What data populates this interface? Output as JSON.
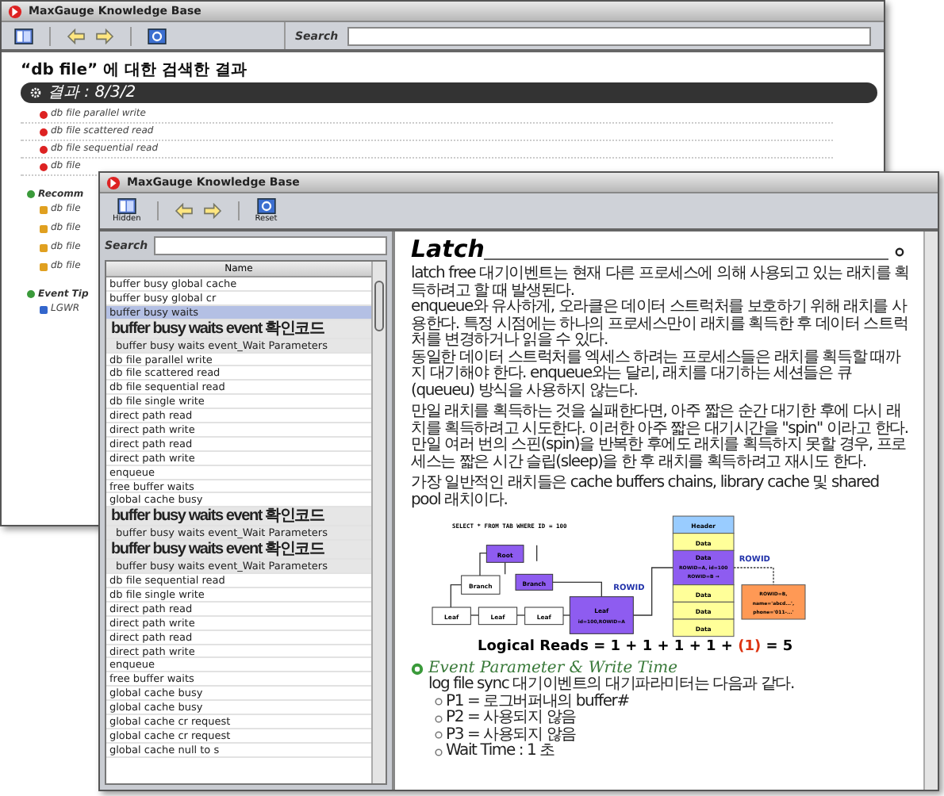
{
  "back_window": {
    "title": "MaxGauge Knowledge Base",
    "toolbar": [
      {
        "kind": "hidden"
      },
      {
        "kind": "back"
      },
      {
        "kind": "forward"
      },
      {
        "kind": "reset"
      }
    ],
    "search_label": "Search",
    "heading": "“db file” 에 대한 검색한 결과",
    "result_bar": "결과 : 8/3/2",
    "results": [
      "db file parallel write",
      "db file scattered read",
      "db file sequential read",
      "db file"
    ],
    "sections": [
      {
        "kind": "recommend",
        "title": "Recomm",
        "items": [
          "db file",
          "db file",
          "db file",
          "db file"
        ]
      },
      {
        "kind": "tip",
        "title": "Event Tip",
        "items": [
          "LGWR"
        ]
      }
    ]
  },
  "front_window": {
    "title": "MaxGauge Knowledge Base",
    "toolbar": [
      {
        "kind": "hidden",
        "label": "Hidden"
      },
      {
        "kind": "back"
      },
      {
        "kind": "forward"
      },
      {
        "kind": "reset",
        "label": "Reset"
      }
    ],
    "search_label": "Search",
    "list_header": "Name",
    "list": [
      {
        "label": "buffer busy global cache",
        "selected": false
      },
      {
        "label": "buffer busy global cr",
        "selected": false
      },
      {
        "label": "buffer busy waits",
        "selected": true,
        "children": [
          {
            "label": "buffer busy waits event 확인코드",
            "bold": true,
            "selected": false
          },
          {
            "label": "buffer busy waits event_Wait Parameters",
            "bold": false,
            "selected": false
          }
        ]
      },
      {
        "label": "db file parallel write",
        "selected": false
      },
      {
        "label": "db file scattered read",
        "selected": false
      },
      {
        "label": "db file sequential read",
        "selected": false
      },
      {
        "label": "db file single write",
        "selected": false
      },
      {
        "label": "direct path read",
        "selected": false
      },
      {
        "label": "direct path write",
        "selected": false
      },
      {
        "label": "direct path read",
        "selected": false
      },
      {
        "label": "direct path write",
        "selected": false
      },
      {
        "label": "enqueue",
        "selected": false
      },
      {
        "label": "free buffer waits",
        "selected": false
      },
      {
        "label": "global cache busy",
        "selected": false,
        "children": [
          {
            "label": "buffer busy waits event 확인코드",
            "bold": true,
            "selected": false
          },
          {
            "label": "buffer busy waits event_Wait Parameters",
            "bold": false,
            "selected": false
          },
          {
            "label": "buffer busy waits event 확인코드",
            "bold": true,
            "selected": false
          },
          {
            "label": "buffer busy waits event_Wait Parameters",
            "bold": false,
            "selected": false
          }
        ]
      },
      {
        "label": "db file sequential read",
        "selected": false
      },
      {
        "label": "db file single write",
        "selected": false
      },
      {
        "label": "direct path read",
        "selected": false
      },
      {
        "label": "direct path write",
        "selected": false
      },
      {
        "label": "direct path read",
        "selected": false
      },
      {
        "label": "direct path write",
        "selected": false
      },
      {
        "label": "enqueue",
        "selected": false
      },
      {
        "label": "free buffer waits",
        "selected": false
      },
      {
        "label": "global cache busy",
        "selected": false
      },
      {
        "label": "global cache busy",
        "selected": false
      },
      {
        "label": "global cache cr request",
        "selected": false
      },
      {
        "label": "global cache cr request",
        "selected": false
      },
      {
        "label": "global cache null to s",
        "selected": false
      }
    ],
    "article": {
      "title": "Latch",
      "paragraphs": [
        [
          "latch free 대기이벤트는 현재 다른 프로세스에 의해 사용되고 있는 래치를 획득하려고 할 때 발생된다.",
          "enqueue와 유사하게, 오라클은 데이터 스트럭처를 보호하기 위해 래치를 사용한다. 특정 시점에는 하나의 프로세스만이 래치를 획득한 후 데이터 스트럭처를 변경하거나 읽을 수 있다.",
          "동일한 데이터 스트럭처를 엑세스 하려는 프로세스들은 래치를 획득할 때까지 대기해야 한다. enqueue와는 달리, 래치를 대기하는 세션들은 큐(queueu) 방식을 사용하지 않는다."
        ],
        [
          "만일 래치를 획득하는 것을 실패한다면, 아주 짧은 순간 대기한 후에 다시 래치를 획득하려고 시도한다. 이러한 아주 짧은 대기시간을 \"spin\" 이라고 한다.",
          "만일 여러 번의 스핀(spin)을 반복한 후에도 래치를 획득하지 못할 경우, 프로세스는 짧은 시간 슬립(sleep)을 한 후 래치를 획득하려고 재시도 한다."
        ],
        [
          "가장 일반적인 래치들은 cache buffers chains, library cache 및 shared pool 래치이다."
        ]
      ],
      "diagram": {
        "query": "SELECT * FROM TAB WHERE ID = 100",
        "root": "Root",
        "branches": [
          "Branch",
          "Branch"
        ],
        "leaves": [
          "Leaf",
          "Leaf",
          "Leaf"
        ],
        "target_leaf": [
          "Leaf",
          "id=100,ROWID=A"
        ],
        "rowid_labels": [
          "ROWID",
          "ROWID"
        ],
        "block_header": "Header",
        "block_rows": [
          {
            "kind": "data",
            "lines": [
              "Data"
            ]
          },
          {
            "kind": "hit",
            "lines": [
              "Data",
              "ROWID=A, id=100",
              "ROWID=B →"
            ]
          },
          {
            "kind": "data",
            "lines": [
              "Data"
            ]
          },
          {
            "kind": "data",
            "lines": [
              "Data"
            ]
          },
          {
            "kind": "data",
            "lines": [
              "Data"
            ]
          }
        ],
        "row_record": [
          "ROWID=B,",
          "name='abcd...',",
          "phone='011-...'"
        ],
        "formula": {
          "before": "Logical Reads = 1 + 1 + 1 + 1 + ",
          "highlight": "(1)",
          "after": " = 5"
        }
      },
      "event": {
        "title": "Event Parameter & Write Time",
        "intro": "log file sync 대기이벤트의 대기파라미터는 다음과 같다.",
        "items": [
          "P1 = 로그버퍼내의 buffer#",
          "P2 = 사용되지 않음",
          "P3 = 사용되지 않음",
          "Wait Time : 1 초"
        ]
      }
    }
  }
}
